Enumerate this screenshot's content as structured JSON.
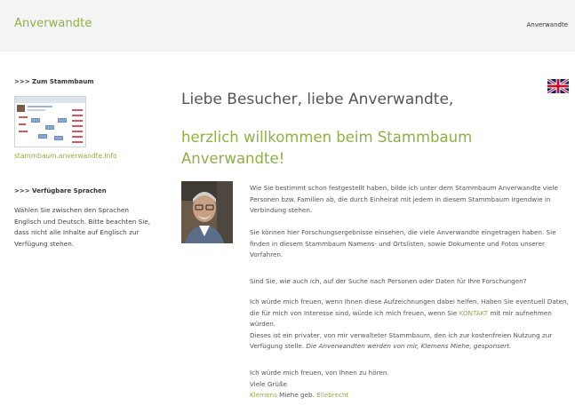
{
  "header": {
    "brand": "Anverwandte",
    "nav_item": "Anverwandte"
  },
  "sidebar": {
    "tree_heading": ">>> Zum Stammbaum",
    "tree_link": "stammbaum.anverwandte.info",
    "lang_heading": ">>> Verfügbare Sprachen",
    "lang_text": "Wählen Sie zwischen den Sprachen Englisch und Deutsch. Bitte beachten Sie, dass nicht alle Inhalte auf Englisch zur Verfügung stehen."
  },
  "language_switch": {
    "icon": "uk-flag-icon"
  },
  "main": {
    "heading": "Liebe Besucher, liebe Anverwandte,",
    "subheading": "herzlich willkommen beim Stammbaum Anverwandte!",
    "p1": "Wie Sie bestimmt schon festgestellt haben, bilde ich unter dem Stammbaum Anverwandte viele Personen bzw. Familien ab, die durch Einheirat mit jedem in diesem Stammbaum irgendwie in Verbindung stehen.",
    "p2": "Sie können hier Forschungsergebnisse einsehen, die viele Anverwandte eingetragen haben. Sie finden in diesem Stammbaum Namens- und Ortslisten, sowie Dokumente und Fotos unserer Vorfahren.",
    "p3": "Sind Sie, wie auch ich, auf der Suche nach Personen oder Daten für Ihre Forschungen?",
    "p4_before": "Ich würde mich freuen, wenn Ihnen diese Aufzeichnungen dabei helfen. Haben Sie eventuell Daten, die für mich von Interesse sind, würde ich mich freuen, wenn Sie ",
    "p4_link": "KONTAKT",
    "p4_after": " mit mir aufnehmen würden.",
    "p5_normal": "Dieses ist ein privater, von mir verwalteter Stammbaum, den ich zur kostenfreien Nutzung zur Verfügung stelle. ",
    "p5_italic": "Die Anverwandten werden von mir, Klemens Miehe, gesponsert.",
    "closing1": "Ich würde mich freuen, von Ihnen zu hören.",
    "closing2": "Viele Grüße",
    "sig_name": "Klemens",
    "sig_mid": " Miehe geb. ",
    "sig_birth": "Ellebrecht"
  }
}
